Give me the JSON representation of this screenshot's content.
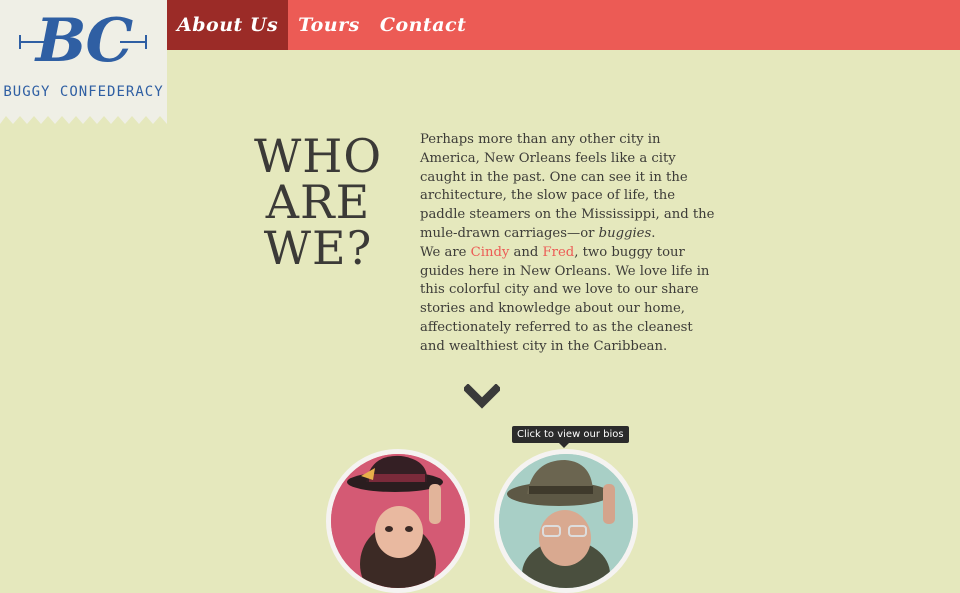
{
  "logo": {
    "initials": "BC",
    "name": "BUGGY CONFEDERACY"
  },
  "nav": {
    "items": [
      "About Us",
      "Tours",
      "Contact"
    ],
    "active_index": 0
  },
  "hero": {
    "heading_lines": [
      "WHO",
      "ARE",
      "WE?"
    ],
    "paragraph1_a": "Perhaps more than any other city in America, New Orleans feels like a city caught in the past. One can see it in the architecture, the slow pace of life, the paddle steamers on the Mississippi, and the mule-drawn carriages—or ",
    "paragraph1_em": "buggies",
    "paragraph1_b": ".",
    "paragraph2_a": "We are ",
    "link_cindy": "Cindy",
    "paragraph2_and": " and ",
    "link_fred": "Fred",
    "paragraph2_b": ", two buggy tour guides here in New Orleans. We love life in this colorful city and we love to our share stories and knowledge about our home, affectionately referred to as the cleanest and wealthiest city in the Caribbean."
  },
  "tooltip": {
    "text": "Click to view our bios"
  },
  "colors": {
    "background": "#e5e8bd",
    "nav_bar": "#ec5b55",
    "nav_active": "#9b2b27",
    "logo_blue": "#2f5fa3",
    "link": "#ec5b55",
    "heading_text": "#3b3a37"
  },
  "icons": {
    "scroll_down": "chevron-down-icon"
  }
}
